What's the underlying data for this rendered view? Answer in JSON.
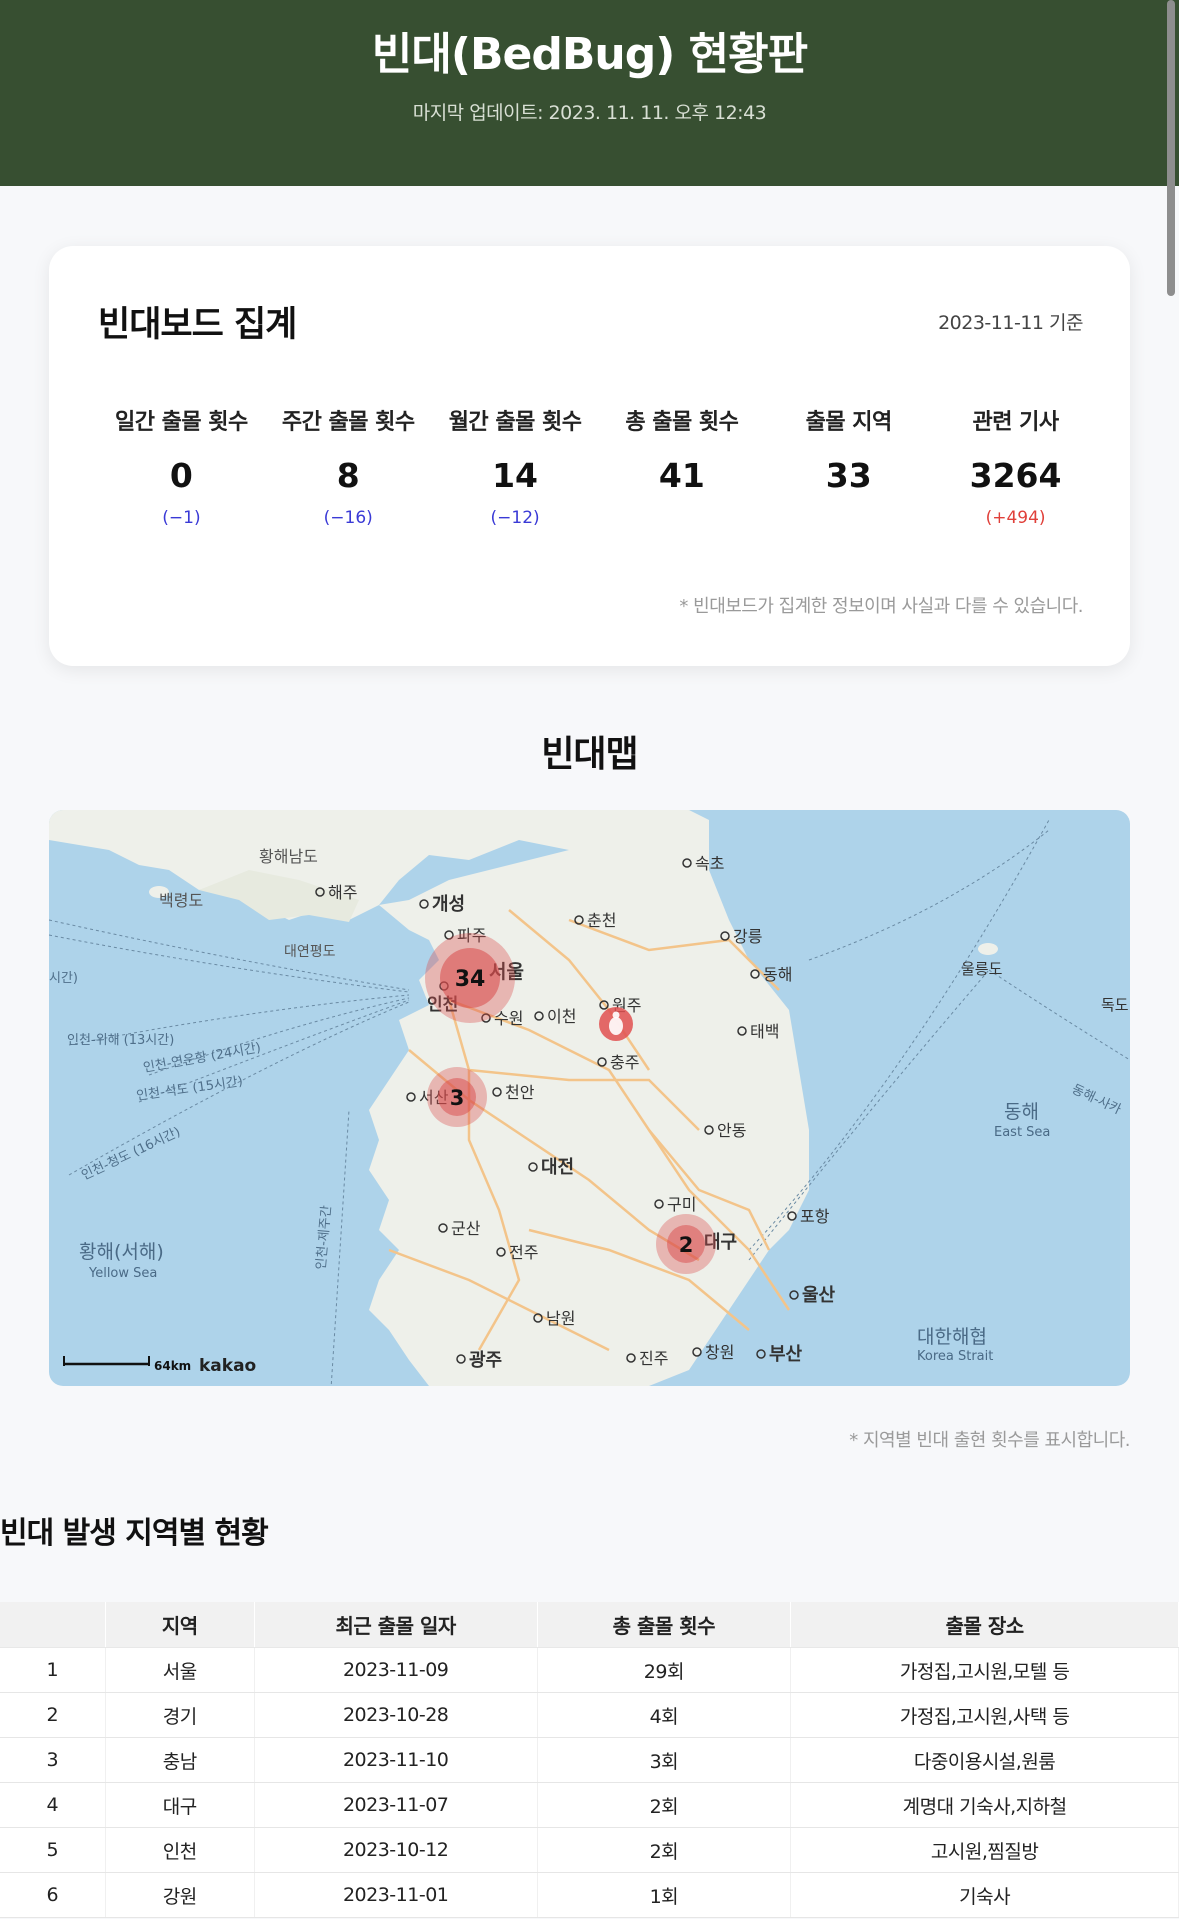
{
  "header": {
    "title": "빈대(BedBug) 현황판",
    "updated": "마지막 업데이트: 2023. 11. 11. 오후 12:43"
  },
  "board": {
    "title": "빈대보드 집계",
    "basis": "2023-11-11 기준",
    "stats": [
      {
        "label": "일간 출몰 횟수",
        "value": "0",
        "change": "(−1)"
      },
      {
        "label": "주간 출몰 횟수",
        "value": "8",
        "change": "(−16)"
      },
      {
        "label": "월간 출몰 횟수",
        "value": "14",
        "change": "(−12)"
      },
      {
        "label": "총 출몰 횟수",
        "value": "41",
        "change": ""
      },
      {
        "label": "출몰 지역",
        "value": "33",
        "change": ""
      },
      {
        "label": "관련 기사",
        "value": "3264",
        "change": "(+494)"
      }
    ],
    "note": "* 빈대보드가 집계한 정보이며 사실과 다를 수 있습니다."
  },
  "map_section": {
    "title": "빈대맵",
    "clusters": [
      {
        "label": "서울",
        "count": "34"
      },
      {
        "label": "서산",
        "count": "3"
      },
      {
        "label": "대구",
        "count": "2"
      }
    ],
    "city_labels": [
      "해주",
      "개성",
      "파주",
      "서울",
      "인천",
      "수원",
      "이천",
      "춘천",
      "원주",
      "충주",
      "서산",
      "천안",
      "대전",
      "군산",
      "전주",
      "남원",
      "광주",
      "구미",
      "대구",
      "포항",
      "울산",
      "부산",
      "창원",
      "진주",
      "안동",
      "속초",
      "강릉",
      "동해",
      "태백",
      "울릉도",
      "독도"
    ],
    "region_labels": [
      "황해남도",
      "백령도",
      "대연평도",
      "황해(서해)",
      "Yellow Sea",
      "동해",
      "East Sea",
      "대한해협",
      "Korea Strait"
    ],
    "route_labels": [
      "인천-위해 (13시간)",
      "인천-연운항 (24시간)",
      "인천-석도 (15시간)",
      "인천-청도 (16시간)",
      "인천-제주간",
      "동해-사카",
      "시간)"
    ],
    "scale": "64km",
    "brand": "kakao",
    "note": "* 지역별 빈대 출현 횟수를 표시합니다."
  },
  "regions": {
    "title": "빈대 발생 지역별 현황",
    "columns": [
      "",
      "지역",
      "최근 출몰 일자",
      "총 출몰 횟수",
      "출몰 장소"
    ],
    "rows": [
      [
        "1",
        "서울",
        "2023-11-09",
        "29회",
        "가정집,고시원,모텔 등"
      ],
      [
        "2",
        "경기",
        "2023-10-28",
        "4회",
        "가정집,고시원,사택 등"
      ],
      [
        "3",
        "충남",
        "2023-11-10",
        "3회",
        "다중이용시설,원룸"
      ],
      [
        "4",
        "대구",
        "2023-11-07",
        "2회",
        "계명대 기숙사,지하철"
      ],
      [
        "5",
        "인천",
        "2023-10-12",
        "2회",
        "고시원,찜질방"
      ],
      [
        "6",
        "강원",
        "2023-11-01",
        "1회",
        "기숙사"
      ]
    ]
  },
  "colors": {
    "header_bg": "#374f31",
    "decrease": "#3a3ad6",
    "increase": "#e0403a",
    "cluster": "#d94a4a",
    "sea": "#aed3ea",
    "land": "#eef0ea"
  }
}
